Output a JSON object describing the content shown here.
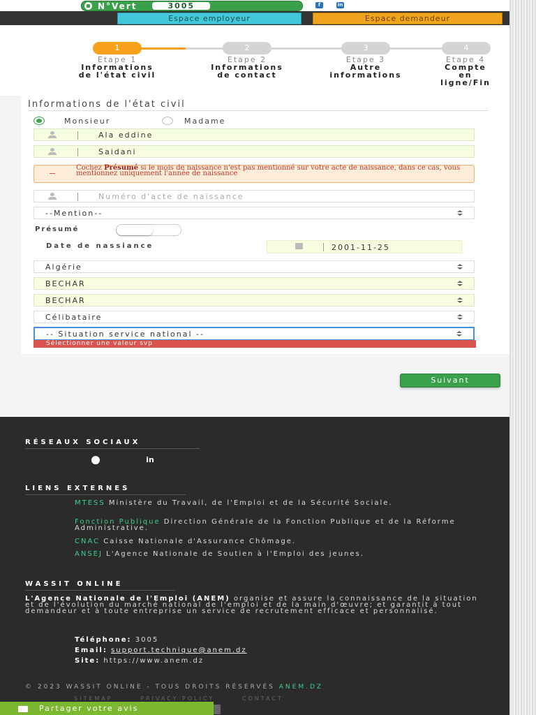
{
  "topbar": {
    "nvert_label": "N°Vert",
    "nvert_number": "3005",
    "employer_button": "Espace employeur",
    "seeker_button": "Espace demandeur",
    "social": [
      "f",
      "in"
    ]
  },
  "stepper": {
    "steps": [
      {
        "number": "1",
        "title": "Etape 1",
        "subtitle_line1": "Informations",
        "subtitle_line2": "de l'état civil",
        "subtitle_line3": ""
      },
      {
        "number": "2",
        "title": "Etape 2",
        "subtitle_line1": "Informations",
        "subtitle_line2": "de contact",
        "subtitle_line3": ""
      },
      {
        "number": "3",
        "title": "Etape 3",
        "subtitle_line1": "Autre",
        "subtitle_line2": "informations",
        "subtitle_line3": ""
      },
      {
        "number": "4",
        "title": "Etape 4",
        "subtitle_line1": "Compte",
        "subtitle_line2": "en",
        "subtitle_line3": "ligne/Fin"
      }
    ],
    "active_step": 1,
    "active_color": "#f7a11a",
    "inactive_color": "#d4d4d4"
  },
  "form": {
    "section_title": "Informations de l'état civil",
    "gender": {
      "option1": "Monsieur",
      "option2": "Madame",
      "selected": "Monsieur"
    },
    "first_name": "Ala eddine",
    "last_name": "Saidani",
    "alert": {
      "bold": "Présumé",
      "before": "Cochez ",
      "after": " si le mois de naissance n'est pas mentionné sur votre acte de naissance, dans ce cas, vous mentionnez uniquement l'année de naissance"
    },
    "birth_act_placeholder": "Numéro d'acte de naissance",
    "mention_select": "--Mention--",
    "presume_label": "Présumé",
    "birth_date_label": "Date de nassiance",
    "birth_date": "2001-11-25",
    "country": "Algérie",
    "wilaya": "BECHAR",
    "commune": "BECHAR",
    "marital_status": "Célibataire",
    "national_service": "-- Situation service national --",
    "error_message": "Sélectionner une valeur svp",
    "next_button": "Suivant"
  },
  "footer": {
    "social_heading": "RÉSEAUX SOCIAUX",
    "social_icons": [
      "facebook-icon",
      "linkedin-icon"
    ],
    "links_heading": "LIENS EXTERNES",
    "links": [
      {
        "key": "MTESS",
        "text": " Ministère du Travail, de l'Emploi et de la Sécurité Sociale."
      },
      {
        "key": "Fonction Publique",
        "text": " Direction Générale de la Fonction Publique et de la Réforme Administrative."
      },
      {
        "key": "CNAC",
        "text": " Caisse Nationale d'Assurance Chômage."
      },
      {
        "key": "ANSEJ",
        "text": " L'Agence Nationale de Soutien à l'Emploi des jeunes."
      }
    ],
    "about_heading": "WASSIT ONLINE",
    "about_bold": "L'Agence Nationale de l'Emploi (ANEM)",
    "about_text": " organise et assure la connaissance de la situation et de l'évolution du marché national de l'emploi et de la main d'œuvre; et garantit à tout demandeur et à toute entreprise un service de recrutement efficace et personnalisé.",
    "phone_label": "Téléphone:",
    "phone": " 3005",
    "email_label": "Email:",
    "email": "support.technique@anem.dz",
    "site_label": "Site:",
    "site": " https://www.anem.dz",
    "copyright": "© 2023 WASSIT ONLINE - TOUS DROITS RÉSERVÉS ",
    "copyright_link": "ANEM.DZ",
    "bottom_links": [
      "SITEMAP",
      "PRIVACY POLICY",
      "CONTACT"
    ],
    "share_button": "Partager votre avis"
  }
}
